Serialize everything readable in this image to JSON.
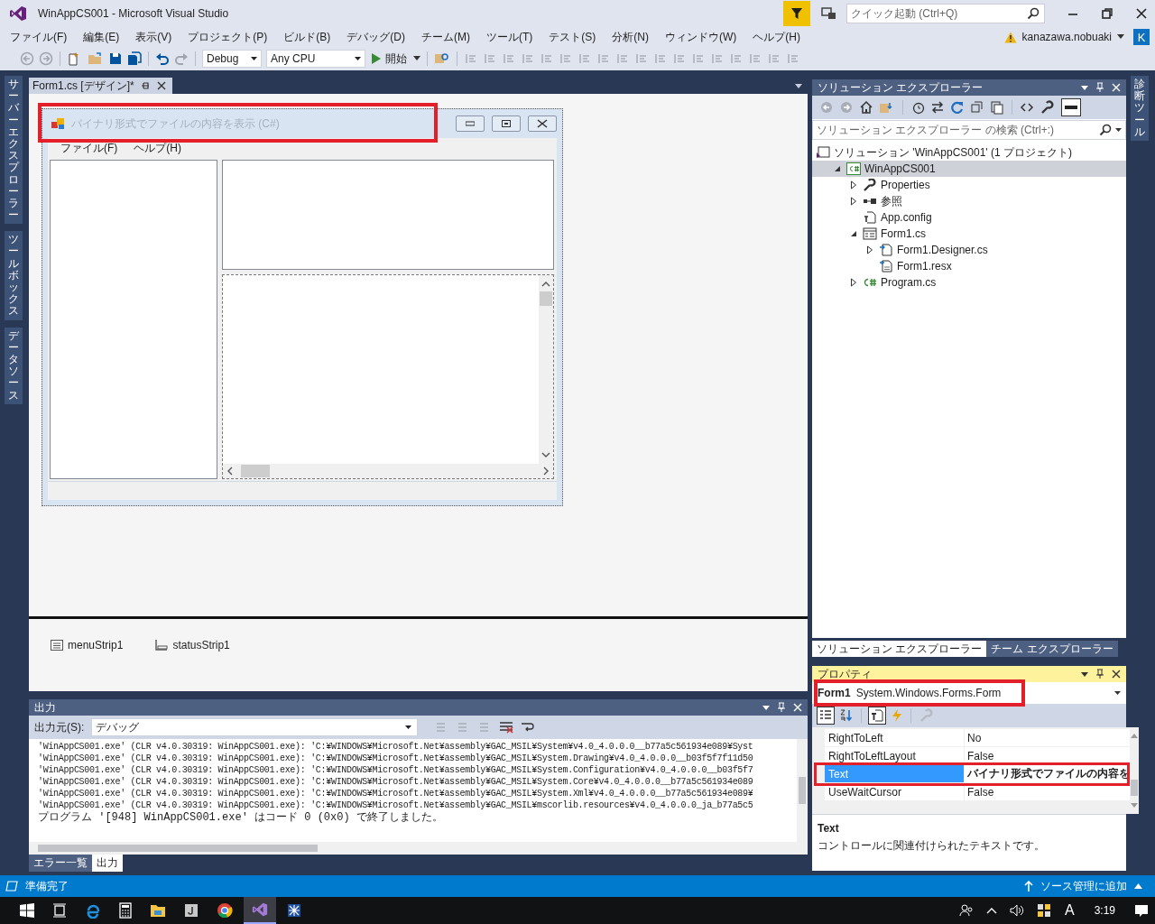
{
  "window": {
    "title": "WinAppCS001 - Microsoft Visual Studio"
  },
  "quick_launch": {
    "placeholder": "クイック起動 (Ctrl+Q)"
  },
  "menu": [
    "ファイル(F)",
    "編集(E)",
    "表示(V)",
    "プロジェクト(P)",
    "ビルド(B)",
    "デバッグ(D)",
    "チーム(M)",
    "ツール(T)",
    "テスト(S)",
    "分析(N)",
    "ウィンドウ(W)",
    "ヘルプ(H)"
  ],
  "account": {
    "name": "kanazawa.nobuaki",
    "initial": "K"
  },
  "toolbar": {
    "configuration": "Debug",
    "platform": "Any CPU",
    "start": "開始"
  },
  "left_tabs": [
    "サーバーエクスプローラー",
    "ツールボックス",
    "データソース"
  ],
  "right_tabs": [
    "診断ツール"
  ],
  "document_tab": {
    "label": "Form1.cs [デザイン]*",
    "selected": true
  },
  "form": {
    "title": "バイナリ形式でファイルの内容を表示 (C#)",
    "highlighted": true,
    "menu": [
      "ファイル(F)",
      "ヘルプ(H)"
    ]
  },
  "component_tray": [
    {
      "name": "menuStrip1",
      "kind": "menu"
    },
    {
      "name": "statusStrip1",
      "kind": "status"
    }
  ],
  "output": {
    "title": "出力",
    "source_label": "出力元(S):",
    "source": "デバッグ",
    "lines": [
      {
        "kind": "load",
        "text": "'WinAppCS001.exe' (CLR v4.0.30319: WinAppCS001.exe): 'C:¥WINDOWS¥Microsoft.Net¥assembly¥GAC_MSIL¥System¥v4.0_4.0.0.0__b77a5c561934e089¥Syst"
      },
      {
        "kind": "load",
        "text": "'WinAppCS001.exe' (CLR v4.0.30319: WinAppCS001.exe): 'C:¥WINDOWS¥Microsoft.Net¥assembly¥GAC_MSIL¥System.Drawing¥v4.0_4.0.0.0__b03f5f7f11d50"
      },
      {
        "kind": "load",
        "text": "'WinAppCS001.exe' (CLR v4.0.30319: WinAppCS001.exe): 'C:¥WINDOWS¥Microsoft.Net¥assembly¥GAC_MSIL¥System.Configuration¥v4.0_4.0.0.0__b03f5f7"
      },
      {
        "kind": "load",
        "text": "'WinAppCS001.exe' (CLR v4.0.30319: WinAppCS001.exe): 'C:¥WINDOWS¥Microsoft.Net¥assembly¥GAC_MSIL¥System.Core¥v4.0_4.0.0.0__b77a5c561934e089"
      },
      {
        "kind": "load",
        "text": "'WinAppCS001.exe' (CLR v4.0.30319: WinAppCS001.exe): 'C:¥WINDOWS¥Microsoft.Net¥assembly¥GAC_MSIL¥System.Xml¥v4.0_4.0.0.0__b77a5c561934e089¥"
      },
      {
        "kind": "load",
        "text": "'WinAppCS001.exe' (CLR v4.0.30319: WinAppCS001.exe): 'C:¥WINDOWS¥Microsoft.Net¥assembly¥GAC_MSIL¥mscorlib.resources¥v4.0_4.0.0.0_ja_b77a5c5"
      },
      {
        "kind": "message",
        "text": "プログラム '[948] WinAppCS001.exe' はコード 0 (0x0) で終了しました。"
      }
    ],
    "tabs": [
      {
        "label": "エラー一覧",
        "selected": false
      },
      {
        "label": "出力",
        "selected": true
      }
    ]
  },
  "solution_explorer": {
    "title": "ソリューション エクスプローラー",
    "search": {
      "placeholder": "ソリューション エクスプローラー の検索 (Ctrl+:)"
    },
    "tree": [
      {
        "label": "ソリューション 'WinAppCS001' (1 プロジェクト)",
        "kind": "solution",
        "selected": false,
        "children": [
          {
            "label": "WinAppCS001",
            "kind": "project",
            "expanded": true,
            "selected": true,
            "children": [
              {
                "label": "Properties",
                "kind": "properties",
                "expanded": false,
                "selected": false
              },
              {
                "label": "参照",
                "kind": "references",
                "expanded": false,
                "selected": false
              },
              {
                "label": "App.config",
                "kind": "config",
                "selected": false
              },
              {
                "label": "Form1.cs",
                "kind": "form",
                "expanded": true,
                "selected": false,
                "children": [
                  {
                    "label": "Form1.Designer.cs",
                    "kind": "code",
                    "expanded": false,
                    "selected": false
                  },
                  {
                    "label": "Form1.resx",
                    "kind": "resource",
                    "selected": false
                  }
                ]
              },
              {
                "label": "Program.cs",
                "kind": "csharp",
                "expanded": false,
                "selected": false
              }
            ]
          }
        ]
      }
    ]
  },
  "panel_tabs": [
    {
      "label": "ソリューション エクスプローラー",
      "selected": true
    },
    {
      "label": "チーム エクスプローラー",
      "selected": false
    }
  ],
  "properties": {
    "title": "プロパティ",
    "object_name": "Form1",
    "object_type": "System.Windows.Forms.Form",
    "selector_highlighted": true,
    "rows": [
      {
        "name": "RightToLeft",
        "value": "No",
        "selected": false,
        "modified": false,
        "highlighted": false
      },
      {
        "name": "RightToLeftLayout",
        "value": "False",
        "selected": false,
        "modified": false,
        "highlighted": false
      },
      {
        "name": "Text",
        "value": "バイナリ形式でファイルの内容を",
        "selected": true,
        "modified": true,
        "highlighted": true
      },
      {
        "name": "UseWaitCursor",
        "value": "False",
        "selected": false,
        "modified": false,
        "highlighted": false
      }
    ],
    "description": {
      "title": "Text",
      "text": "コントロールに関連付けられたテキストです。"
    }
  },
  "status_bar": {
    "text": "準備完了",
    "source_control": "ソース管理に追加"
  },
  "taskbar": {
    "ime": "A",
    "time": "3:19"
  }
}
